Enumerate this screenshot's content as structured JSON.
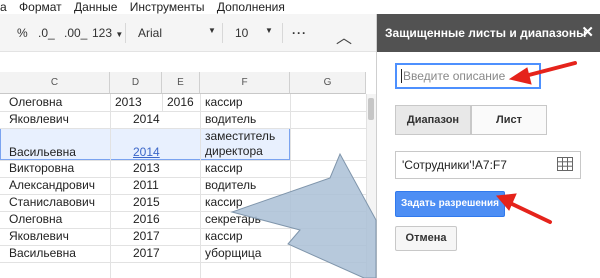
{
  "menu": [
    "а",
    "Формат",
    "Данные",
    "Инструменты",
    "Дополнения"
  ],
  "toolbar": {
    "percent": "%",
    "dec_decrease": ".0_",
    "dec_increase": ".00_",
    "more_formats": "123",
    "font": "Arial",
    "font_size": "10",
    "more": "···"
  },
  "columns": [
    "C",
    "D",
    "E",
    "F",
    "G"
  ],
  "rows": [
    {
      "c": "Олеговна",
      "d": "2013",
      "e": "2016",
      "f": "кассир"
    },
    {
      "c": "Яковлевич",
      "de": "2014",
      "f": "водитель"
    },
    {
      "c": "Васильевна",
      "de": "2014",
      "f1": "заместитель",
      "f2": "директора"
    },
    {
      "c": "Викторовна",
      "de": "2013",
      "f": "кассир"
    },
    {
      "c": "Александрович",
      "de": "2011",
      "f": "водитель"
    },
    {
      "c": "Станиславович",
      "de": "2015",
      "f": "кассир"
    },
    {
      "c": "Олеговна",
      "de": "2016",
      "f": "секретарь"
    },
    {
      "c": "Яковлевич",
      "de": "2017",
      "f": "кассир"
    },
    {
      "c": "Васильевна",
      "de": "2017",
      "f": "уборщица"
    }
  ],
  "panel": {
    "title": "Защищенные листы и диапазоны",
    "description_placeholder": "Введите описание",
    "tab_range": "Диапазон",
    "tab_sheet": "Лист",
    "range_value": "'Сотрудники'!A7:F7",
    "set_permissions": "Задать разрешения",
    "cancel": "Отмена"
  },
  "colors": {
    "accent_blue": "#4d8ef4",
    "arrow_red": "#e5231b",
    "panel_header": "#525252",
    "selection_fill": "#e8f0fe"
  }
}
